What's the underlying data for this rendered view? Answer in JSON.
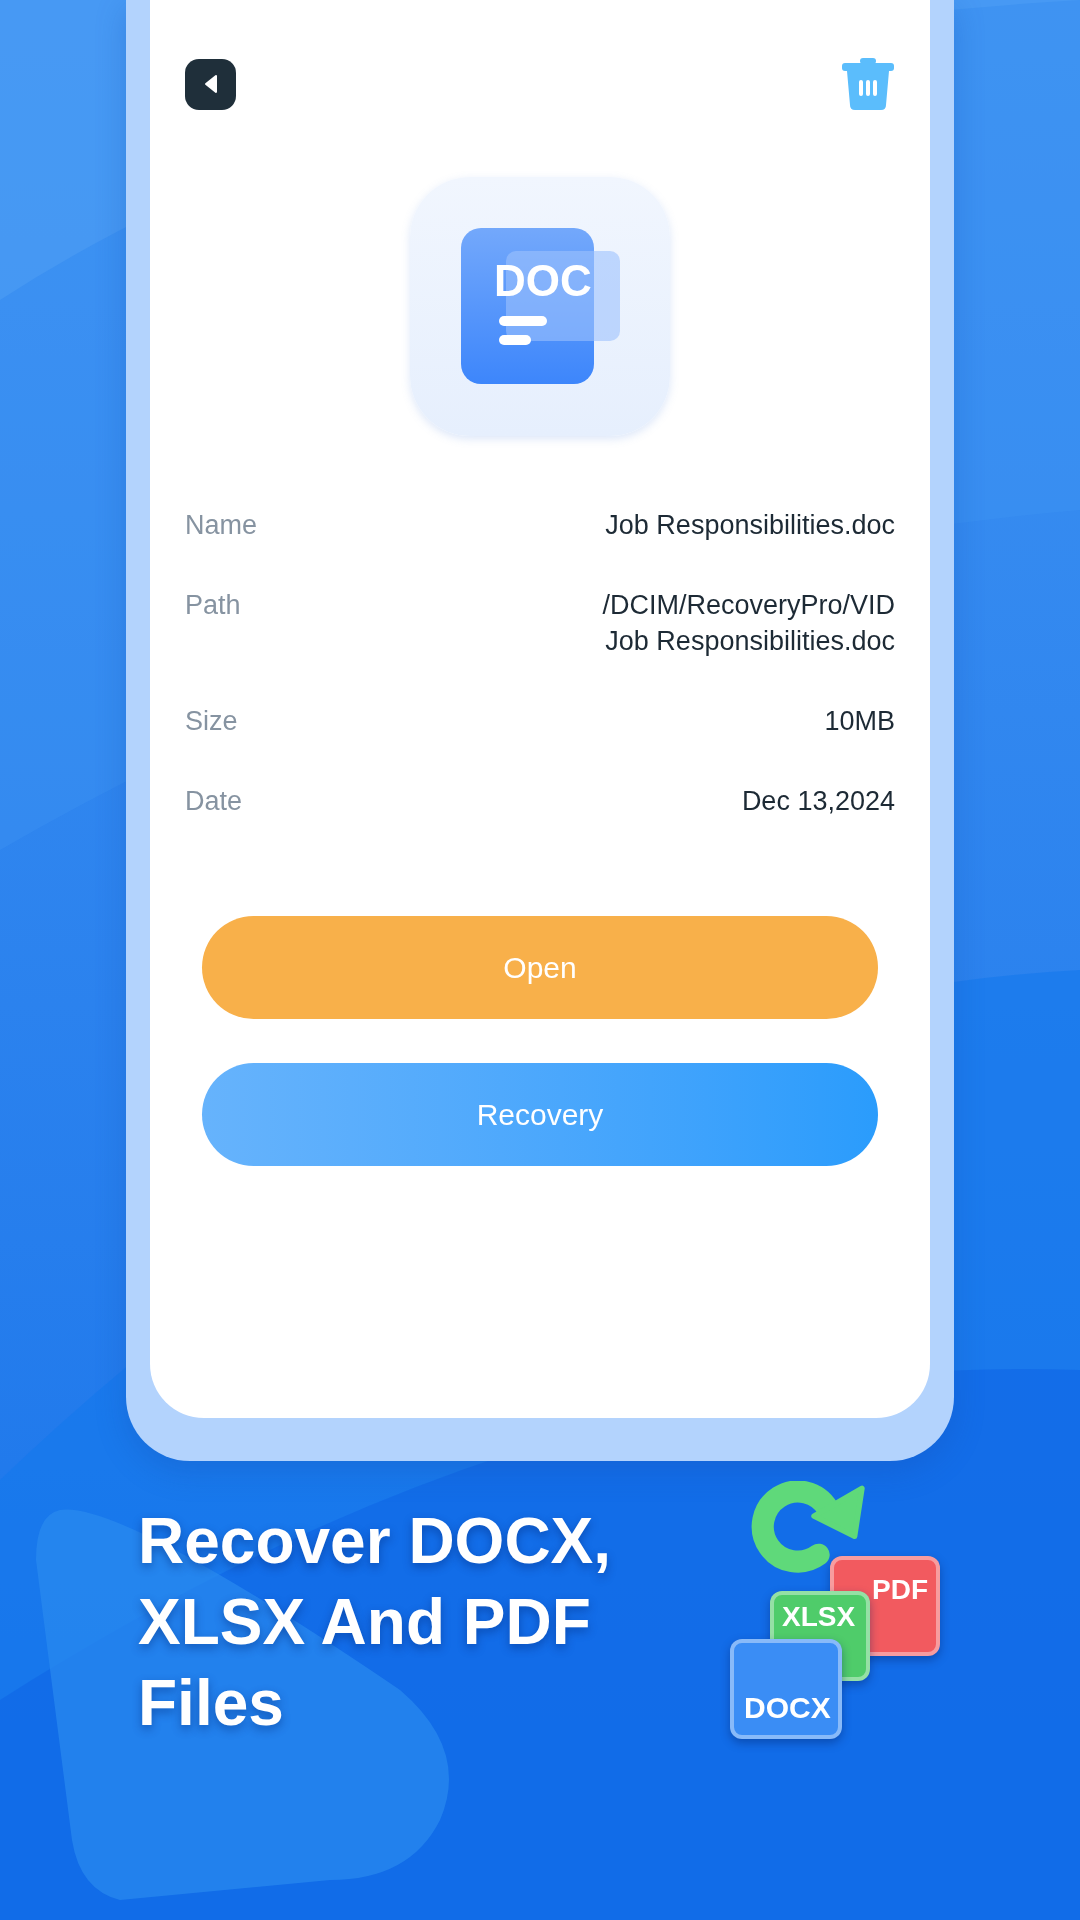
{
  "file_type_label": "DOC",
  "details": [
    {
      "label": "Name",
      "value": "Job Responsibilities.doc"
    },
    {
      "label": "Path",
      "value": "/DCIM/RecoveryPro/VID\nJob Responsibilities.doc"
    },
    {
      "label": "Size",
      "value": "10MB"
    },
    {
      "label": "Date",
      "value": "Dec 13,2024"
    }
  ],
  "buttons": [
    {
      "label": "Open",
      "kind": "primary"
    },
    {
      "label": "Recovery",
      "kind": "secondary"
    }
  ],
  "headline": "Recover DOCX, XLSX And PDF Files",
  "illustration_tiles": [
    {
      "label": "PDF",
      "color": "#f25a5f"
    },
    {
      "label": "XLSX",
      "color": "#4fcc6a"
    },
    {
      "label": "DOCX",
      "color": "#3a8df5"
    }
  ]
}
